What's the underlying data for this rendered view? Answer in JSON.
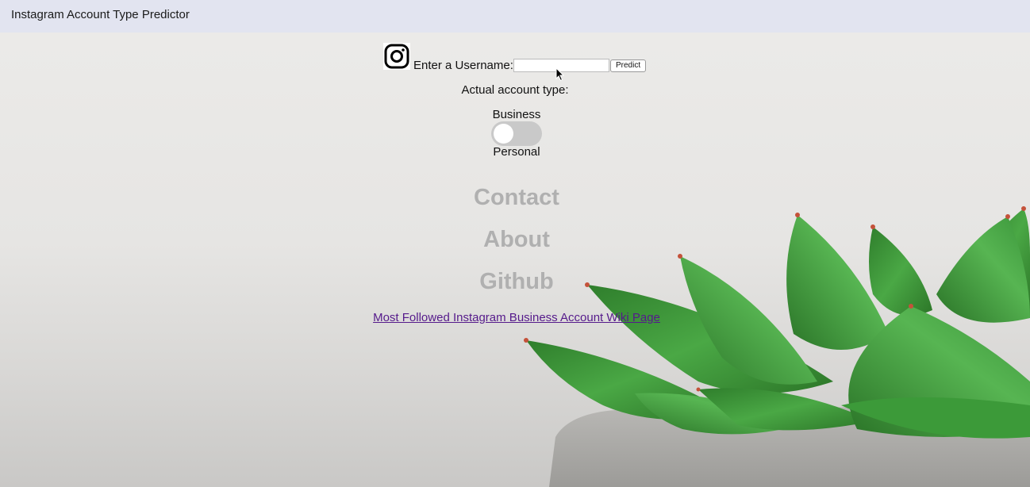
{
  "header": {
    "title": "Instagram Account Type Predictor"
  },
  "form": {
    "username_label": "Enter a Username:",
    "username_value": "",
    "username_placeholder": "",
    "predict_label": "Predict"
  },
  "result": {
    "actual_label": "Actual account type:",
    "option_top": "Business",
    "option_bottom": "Personal",
    "toggle_on": false
  },
  "nav": {
    "contact": "Contact",
    "about": "About",
    "github": "Github"
  },
  "links": {
    "wiki": "Most Followed Instagram Business Account Wiki Page"
  },
  "icons": {
    "logo": "instagram-icon",
    "pointer": "mouse-cursor-icon"
  },
  "colors": {
    "header_bg": "#e2e4f0",
    "nav_text": "#b0b0b0",
    "link_visited": "#551a8b",
    "toggle_track": "#c9c9c9",
    "plant_green": "#3e9a3b"
  }
}
